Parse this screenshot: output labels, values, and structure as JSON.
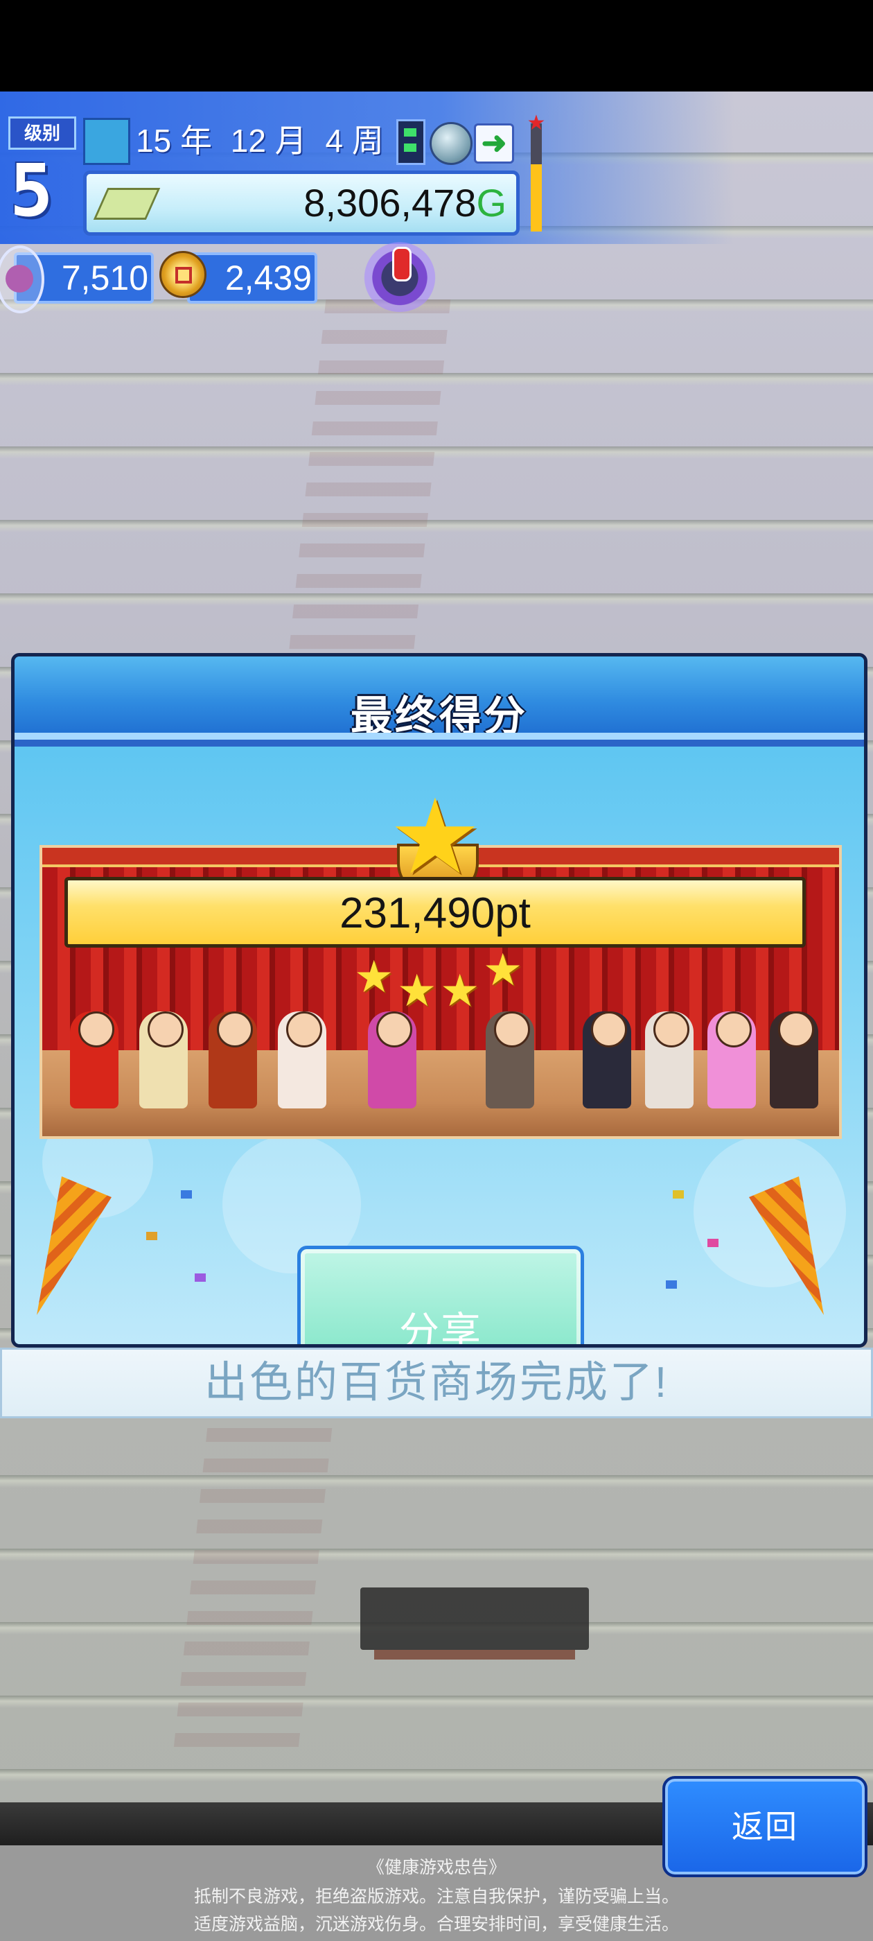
{
  "hud": {
    "level_label": "级别",
    "level_value": "5",
    "date": {
      "year": "15 年",
      "month": "12 月",
      "week": "4 周"
    },
    "money": {
      "value": "8,306,478",
      "unit": "G"
    },
    "research_points": "7,510",
    "coins": "2,439",
    "gauge_fill_fraction": 0.62,
    "icons": [
      "calendar-icon",
      "speed-icon",
      "globe-icon",
      "next-arrow-icon",
      "star-gauge-icon",
      "cash-icon",
      "research-ticket-icon",
      "coin-icon",
      "alarm-icon"
    ]
  },
  "dialog": {
    "title": "最终得分",
    "score": "231,490pt",
    "stars_count": 4,
    "share_button": "分享"
  },
  "banner": {
    "text": "出色的百货商场完成了!"
  },
  "back_button": "返回",
  "notice": {
    "title": "《健康游戏忠告》",
    "line1": "抵制不良游戏，拒绝盗版游戏。注意自我保护，谨防受骗上当。",
    "line2": "适度游戏益脑，沉迷游戏伤身。合理安排时间，享受健康生活。"
  },
  "colors": {
    "accent": "#2f6ee0",
    "money_unit": "#2cb33f",
    "share_button": "#8be8cc",
    "back_button": "#1a66e8"
  }
}
